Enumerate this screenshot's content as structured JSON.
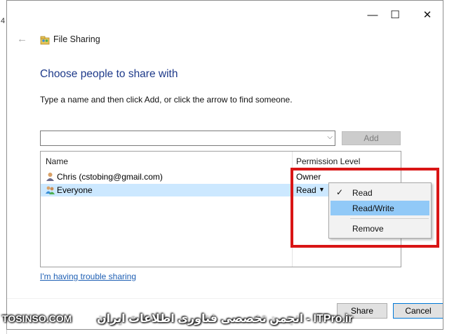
{
  "background": {
    "partial_text": "4"
  },
  "window": {
    "caption": {
      "minimize": "—",
      "maximize": "☐",
      "close": "✕"
    },
    "title": "File Sharing",
    "heading": "Choose people to share with",
    "instruction": "Type a name and then click Add, or click the arrow to find someone.",
    "name_input": {
      "value": "",
      "placeholder": ""
    },
    "add_label": "Add",
    "columns": {
      "name": "Name",
      "permission": "Permission Level"
    },
    "rows": [
      {
        "name": "Chris (cstobing@gmail.com)",
        "permission": "Owner"
      },
      {
        "name": "Everyone",
        "permission": "Read"
      }
    ],
    "context_menu": {
      "items": [
        {
          "label": "Read",
          "checked": "✓"
        },
        {
          "label": "Read/Write"
        },
        {
          "label": "Remove"
        }
      ]
    },
    "trouble_link": "I'm having trouble sharing",
    "share_label": "Share",
    "cancel_label": "Cancel"
  },
  "watermark": {
    "left": "TOSINSO.COM",
    "right": "انجمن تخصصی فناوری اطلاعات ایران - ITPro.ir"
  },
  "colors": {
    "accent": "#0078d7",
    "highlight": "#d91515",
    "heading": "#1e3a8a",
    "selection": "#cce8ff",
    "menu_hover": "#91c9f7"
  }
}
